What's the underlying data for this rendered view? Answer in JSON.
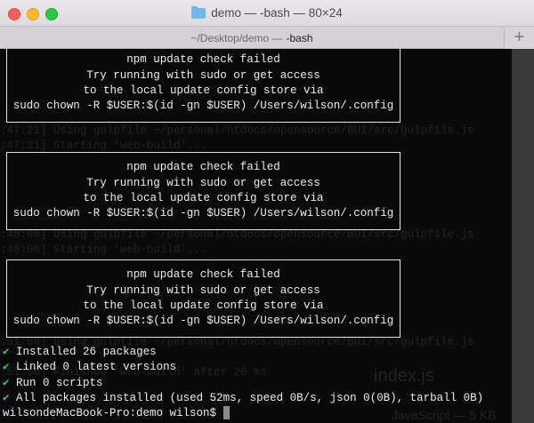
{
  "window": {
    "title": "demo — -bash — 80×24",
    "tab_path": "~/Desktop/demo —",
    "tab_active": "-bash",
    "new_tab_label": "+"
  },
  "boxes": [
    [
      "npm update check failed",
      "Try running with sudo or get access",
      "to the local update config store via",
      "sudo chown -R $USER:$(id -gn $USER) /Users/wilson/.config"
    ],
    [
      "npm update check failed",
      "Try running with sudo or get access",
      "to the local update config store via",
      "sudo chown -R $USER:$(id -gn $USER) /Users/wilson/.config"
    ],
    [
      "npm update check failed",
      "Try running with sudo or get access",
      "to the local update config store via",
      "sudo chown -R $USER:$(id -gn $USER) /Users/wilson/.config"
    ]
  ],
  "results": [
    {
      "icon": "✔",
      "text": "Installed 26 packages"
    },
    {
      "icon": "✔",
      "text": "Linked 0 latest versions"
    },
    {
      "icon": "✔",
      "text": "Run 0 scripts"
    },
    {
      "icon": "✔",
      "text": "All packages installed (used 52ms, speed 0B/s, json 0(0B), tarball 0B)"
    }
  ],
  "prompt": "wilsondeMacBook-Pro:demo wilson$ ",
  "background_text": [
    ":47:21] Using gulpfile ~/personal/htdocs/opensource/BUI/src/gulpfile.js",
    ":47:21] Starting 'web-build'...",
    ":48:06] Using gulpfile ~/personal/htdocs/opensource/BUI/src/gulpfile.js",
    ":48:06] Starting 'web-build'...",
    ":51:50] Using gulpfile ~/personal/htdocs/opensource/BUI/src/gulpfile.js",
    ":51:50] Finished 'web-build' after 20 ms",
    "index.js",
    "JavaScript — 5 KB"
  ],
  "colors": {
    "check": "#4cc94c",
    "text": "#ececec",
    "background": "#080808"
  }
}
